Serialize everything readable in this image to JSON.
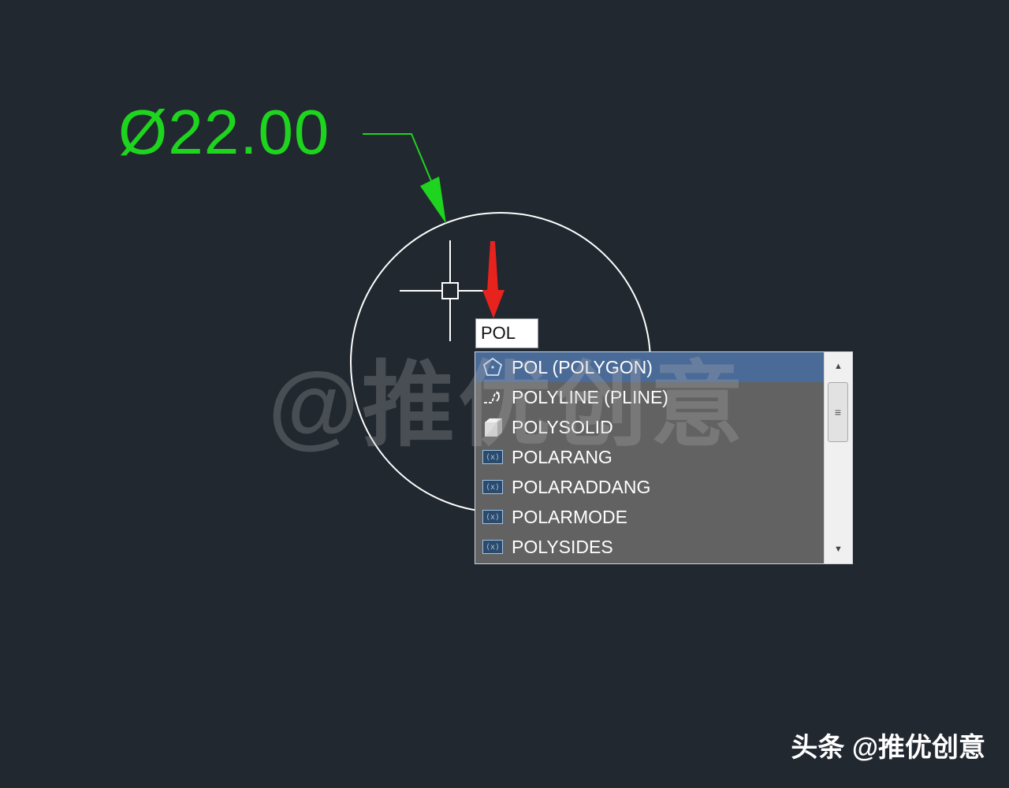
{
  "drawing": {
    "dimension_text": "Ø22.00",
    "colors": {
      "background": "#212830",
      "dimension": "#1ed41e",
      "circle": "#ffffff",
      "pointer_arrow": "#e8231e"
    }
  },
  "command_line": {
    "input_value": "POL"
  },
  "autocomplete": {
    "items": [
      {
        "label": "POL (POLYGON)",
        "icon": "polygon-icon",
        "selected": true
      },
      {
        "label": "POLYLINE (PLINE)",
        "icon": "polyline-icon",
        "selected": false
      },
      {
        "label": "POLYSOLID",
        "icon": "polysolid-icon",
        "selected": false
      },
      {
        "label": "POLARANG",
        "icon": "system-variable-icon",
        "selected": false
      },
      {
        "label": "POLARADDANG",
        "icon": "system-variable-icon",
        "selected": false
      },
      {
        "label": "POLARMODE",
        "icon": "system-variable-icon",
        "selected": false
      },
      {
        "label": "POLYSIDES",
        "icon": "system-variable-icon",
        "selected": false
      }
    ],
    "scroll": {
      "up_glyph": "▲",
      "down_glyph": "▼",
      "thumb_glyph": "≡"
    }
  },
  "watermark": {
    "overlay": "@推优创意",
    "stamp": "头条 @推优创意"
  }
}
